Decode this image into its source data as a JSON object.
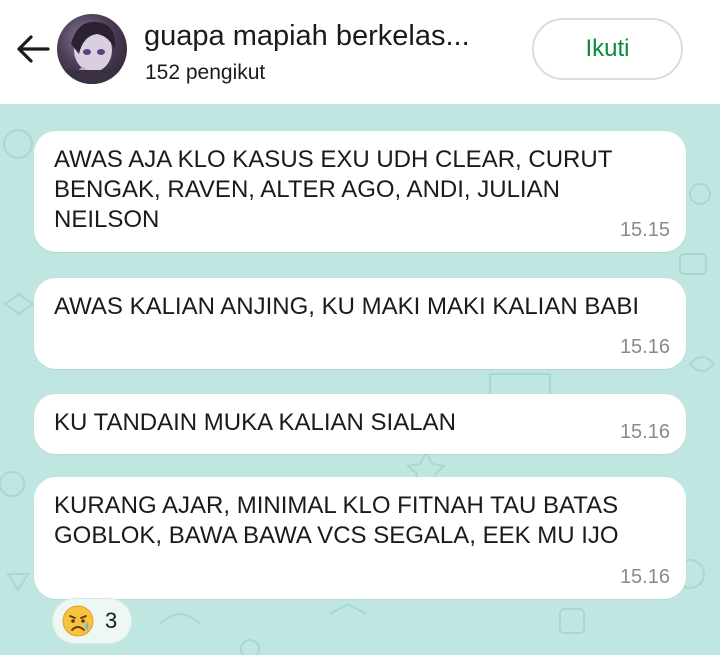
{
  "header": {
    "channel_name": "guapa mapiah berkelas...",
    "followers": "152 pengikut",
    "follow_label": "Ikuti"
  },
  "colors": {
    "chat_background": "#bfe6e0",
    "follow_text": "#0a8a3c",
    "bubble": "#ffffff"
  },
  "messages": [
    {
      "text": "AWAS AJA KLO KASUS EXU UDH CLEAR, CURUT BENGAK, RAVEN, ALTER AGO, ANDI, JULIAN NEILSON",
      "time": "15.15"
    },
    {
      "text": "AWAS KALIAN ANJING, KU MAKI MAKI KALIAN BABI",
      "time": "15.16"
    },
    {
      "text": "KU TANDAIN MUKA KALIAN SIALAN",
      "time": "15.16"
    },
    {
      "text": "KURANG AJAR, MINIMAL KLO FITNAH TAU BATAS GOBLOK, BAWA BAWA VCS SEGALA, EEK MU IJO",
      "time": "15.16"
    }
  ],
  "reaction": {
    "emoji": "sad-but-relieved-face",
    "count": "3"
  }
}
